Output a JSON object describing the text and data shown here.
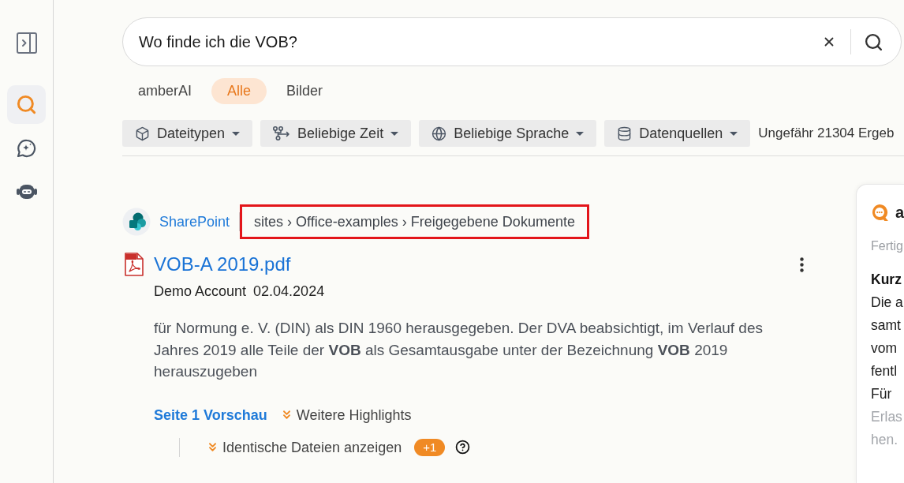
{
  "sidebar": {
    "items": [
      {
        "kind": "search",
        "selected": true
      },
      {
        "kind": "assistant",
        "selected": false
      },
      {
        "kind": "bot",
        "selected": false
      }
    ]
  },
  "search": {
    "value": "Wo finde ich die VOB?"
  },
  "tabs": [
    {
      "label": "amberAI",
      "selected": false
    },
    {
      "label": "Alle",
      "selected": true
    },
    {
      "label": "Bilder",
      "selected": false
    }
  ],
  "filters": [
    {
      "label": "Dateitypen",
      "kind": "filetype"
    },
    {
      "label": "Beliebige Zeit",
      "kind": "time"
    },
    {
      "label": "Beliebige Sprache",
      "kind": "language"
    },
    {
      "label": "Datenquellen",
      "kind": "source"
    }
  ],
  "result_count": "Ungefähr 21304 Ergeb",
  "results": [
    {
      "source": "SharePoint",
      "path": "sites › Office-examples › Freigegebene Dokumente",
      "path_highlighted": true,
      "title": "VOB-A 2019.pdf",
      "author": "Demo Account",
      "date": "02.04.2024",
      "snippet": "für Normung e. V. (DIN) als DIN 1960 herausgegeben. Der DVA beabsichtigt, im Verlauf des Jahres 2019 alle Teile der **VOB** als Gesamtausgabe unter der Bezeichnung **VOB** 2019 herauszugeben",
      "preview_link": "Seite 1 Vorschau",
      "more_highlights": "Weitere Highlights",
      "identical_files": "Identische Dateien anzeigen",
      "identical_count": "+1"
    }
  ],
  "ai_panel": {
    "title": "a",
    "status": "Fertig",
    "heading": "Kurz",
    "lines": [
      "Die a",
      "samt",
      "vom",
      "fentl",
      "Für",
      "Erlas",
      "hen."
    ]
  }
}
